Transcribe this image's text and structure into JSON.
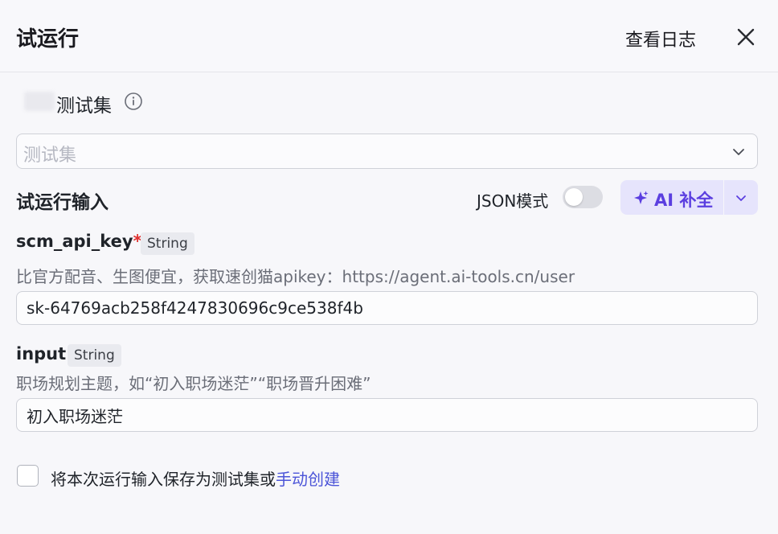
{
  "header": {
    "title": "试运行",
    "view_log": "查看日志"
  },
  "testset": {
    "label": "测试集",
    "placeholder": "测试集"
  },
  "run_input": {
    "label": "试运行输入",
    "json_mode_label": "JSON模式",
    "json_mode_on": false,
    "ai_button_label": "AI 补全"
  },
  "fields": [
    {
      "name": "scm_api_key",
      "required_mark": "*",
      "type": "String",
      "description": "比官方配音、生图便宜，获取速创猫apikey：https://agent.ai-tools.cn/user",
      "value": "sk-64769acb258f4247830696c9ce538f4b"
    },
    {
      "name": "input",
      "type": "String",
      "description": "职场规划主题，如“初入职场迷茫”“职场晋升困难”",
      "value": "初入职场迷茫"
    }
  ],
  "save": {
    "checked": false,
    "text": "将本次运行输入保存为测试集或",
    "link": "手动创建"
  },
  "colors": {
    "accent": "#5b3fe0",
    "link": "#4c55d8",
    "required": "#e0302f"
  }
}
